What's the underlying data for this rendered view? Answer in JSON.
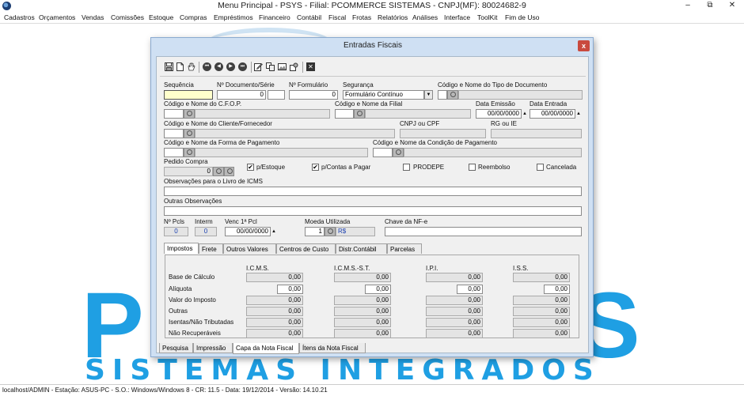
{
  "window": {
    "title": "Menu Principal - PSYS - Filial: PCOMMERCE SISTEMAS - CNPJ(MF): 80024682-9",
    "minimize": "–",
    "restore": "⧉",
    "close": "✕"
  },
  "menu": [
    "Cadastros",
    "Orçamentos",
    "Vendas",
    "Comissões",
    "Estoque",
    "Compras",
    "Empréstimos",
    "Financeiro",
    "Contábil",
    "Fiscal",
    "Frotas",
    "Relatórios",
    "Análises",
    "Interface",
    "ToolKit",
    "Fim de Uso"
  ],
  "background_logo": {
    "letters": [
      "P",
      "S"
    ],
    "tagline": "SISTEMAS INTEGRADOS",
    "color": "#1f9fe3"
  },
  "status": "localhost/ADMIN - Estação: ASUS-PC - S.O.: Windows/Windows 8 - CR: 11.5  - Data: 19/12/2014 - Versão: 14.10.21",
  "dialog": {
    "title": "Entradas Fiscais",
    "close": "x",
    "toolbar_close": "✕",
    "nav": [
      "⏮",
      "◀",
      "▶",
      "⏭"
    ],
    "labels": {
      "sequencia": "Sequência",
      "documento": "Nº Documento/Série",
      "formulario": "Nº Formulário",
      "seguranca": "Segurança",
      "tipo_documento": "Código e Nome do Tipo de Documento",
      "cfop": "Código e Nome do C.F.O.P.",
      "filial": "Código e Nome da Filial",
      "data_emissao": "Data Emissão",
      "data_entrada": "Data Entrada",
      "cliente": "Código e Nome do Cliente/Fornecedor",
      "cnpj": "CNPJ ou CPF",
      "rg": "RG ou IE",
      "forma_pagamento": "Código e Nome da Forma de Pagamento",
      "condicao_pagamento": "Código e Nome da Condição de Pagamento",
      "pedido_compra": "Pedido Compra",
      "obs_icms": "Observações para o Livro de ICMS",
      "outras_obs": "Outras Observações",
      "n_pcls": "Nº Pcls",
      "interm": "Interm",
      "venc_pcl": "Venc 1ª Pcl",
      "moeda": "Moeda Utilizada",
      "chave_nfe": "Chave da NF-e"
    },
    "values": {
      "documento": "0",
      "formulario": "0",
      "seguranca": "Formulário Contínuo",
      "data_emissao": "00/00/0000",
      "data_entrada": "00/00/0000",
      "pedido_compra": "0",
      "n_pcls": "0",
      "interm": "0",
      "venc_pcl": "00/00/0000",
      "moeda_codigo": "1",
      "moeda_simbolo": "R$"
    },
    "checkboxes": {
      "p_estoque": {
        "label": "p/Estoque",
        "checked": true
      },
      "p_contas_pagar": {
        "label": "p/Contas a Pagar",
        "checked": true
      },
      "prodepe": {
        "label": "PRODEPE",
        "checked": false
      },
      "reembolso": {
        "label": "Reembolso",
        "checked": false
      },
      "cancelada": {
        "label": "Cancelada",
        "checked": false
      }
    },
    "check_mark": "✔",
    "tabs": [
      "Impostos",
      "Frete",
      "Outros Valores",
      "Centros de Custo",
      "Distr.Contábil",
      "Parcelas"
    ],
    "active_tab": "Impostos",
    "tax_columns": [
      "I.C.M.S.",
      "I.C.M.S.-S.T.",
      "I.P.I.",
      "I.S.S."
    ],
    "tax_rows": [
      {
        "label": "Base de Cálculo",
        "values": [
          "0,00",
          "0,00",
          "0,00",
          "0,00"
        ]
      },
      {
        "label": "Alíquota",
        "values": [
          "0,00",
          "0,00",
          "0,00",
          "0,00"
        ]
      },
      {
        "label": "Valor do Imposto",
        "values": [
          "0,00",
          "0,00",
          "0,00",
          "0,00"
        ]
      },
      {
        "label": "Outras",
        "values": [
          "0,00",
          "0,00",
          "0,00",
          "0,00"
        ]
      },
      {
        "label": "Isentas/Não Tributadas",
        "values": [
          "0,00",
          "0,00",
          "0,00",
          "0,00"
        ]
      },
      {
        "label": "Não Recuperáveis",
        "values": [
          "0,00",
          "0,00",
          "0,00",
          "0,00"
        ]
      }
    ],
    "bottom_tabs": [
      "Pesquisa",
      "Impressão",
      "Capa da Nota Fiscal",
      "Ítens da Nota Fiscal"
    ],
    "active_bottom_tab": "Capa da Nota Fiscal"
  }
}
